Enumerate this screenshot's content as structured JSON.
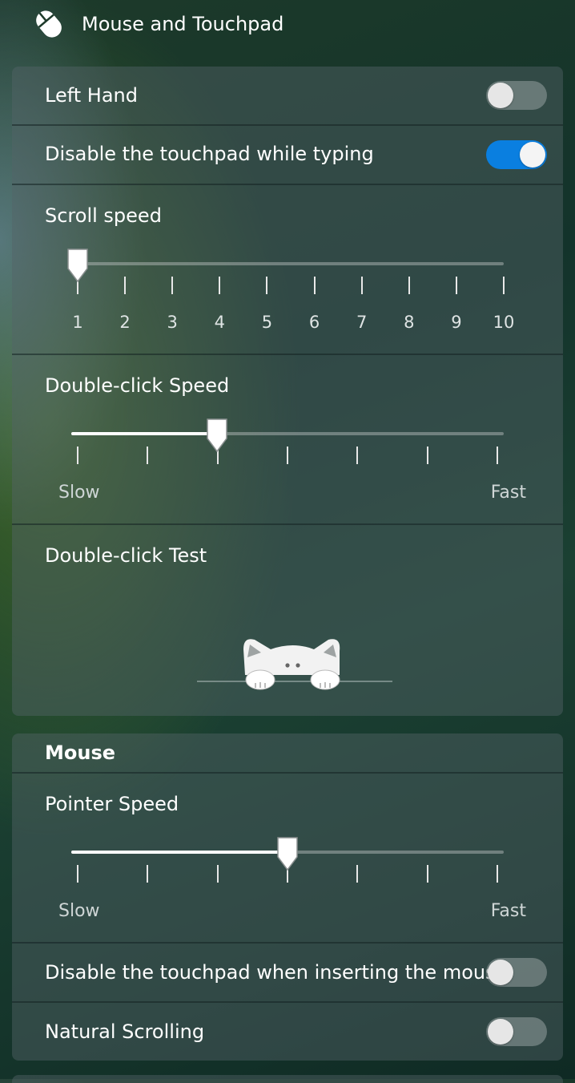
{
  "header": {
    "title": "Mouse and Touchpad",
    "icon": "mouse-icon"
  },
  "general": {
    "left_hand": {
      "label": "Left Hand",
      "on": false
    },
    "disable_while_typing": {
      "label": "Disable the touchpad while typing",
      "on": true
    },
    "scroll_speed": {
      "label": "Scroll speed",
      "ticks": [
        "1",
        "2",
        "3",
        "4",
        "5",
        "6",
        "7",
        "8",
        "9",
        "10"
      ],
      "value": 1
    },
    "double_click_speed": {
      "label": "Double-click Speed",
      "min_label": "Slow",
      "max_label": "Fast",
      "steps": 7,
      "value_fraction": 0.333
    },
    "double_click_test": {
      "label": "Double-click Test",
      "image": "cat-peek-icon"
    }
  },
  "mouse": {
    "title": "Mouse",
    "pointer_speed": {
      "label": "Pointer Speed",
      "min_label": "Slow",
      "max_label": "Fast",
      "steps": 7,
      "value_fraction": 0.5
    },
    "disable_touchpad_mouse": {
      "label": "Disable the touchpad when inserting the mouse",
      "on": false
    },
    "natural_scrolling": {
      "label": "Natural Scrolling",
      "on": false
    }
  },
  "colors": {
    "accent": "#0a7fe0"
  }
}
